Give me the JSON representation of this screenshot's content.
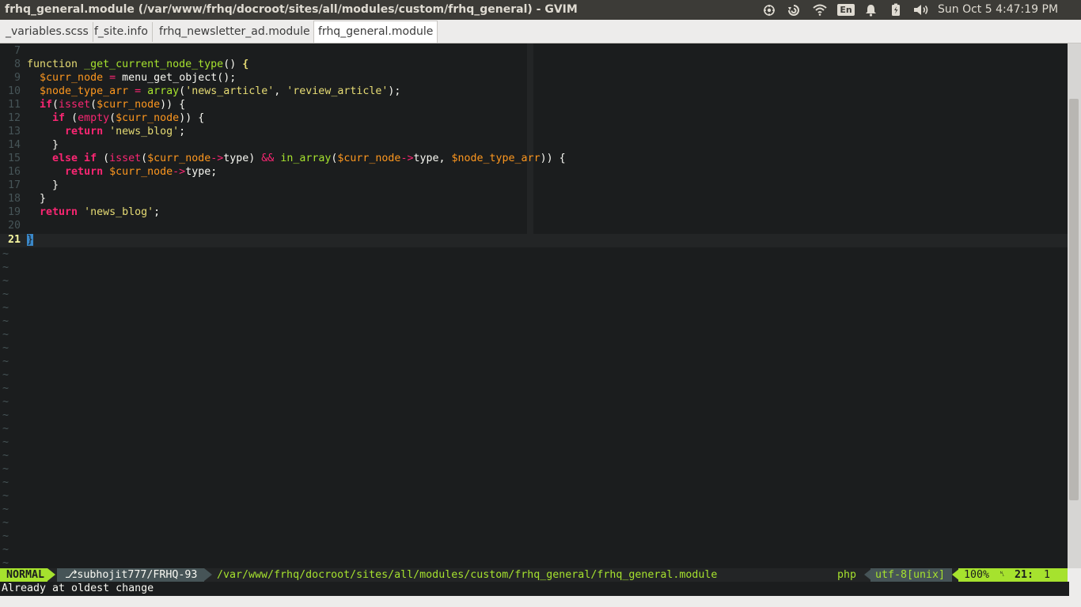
{
  "window": {
    "title": "frhq_general.module (/var/www/frhq/docroot/sites/all/modules/custom/frhq_general) - GVIM"
  },
  "tray": {
    "icons": [
      "sync-indicator-icon",
      "dropbox-icon",
      "wifi-icon",
      "keyboard-layout-icon",
      "notification-icon",
      "battery-icon",
      "volume-icon"
    ],
    "keyboard_layout": "En",
    "clock": "Sun Oct  5  4:47:19 PM"
  },
  "tabs": [
    {
      "label": "_variables.scss",
      "active": false
    },
    {
      "label": "f_site.info",
      "active": false
    },
    {
      "label": "frhq_newsletter_ad.module",
      "active": false
    },
    {
      "label": "frhq_general.module",
      "active": true
    }
  ],
  "editor": {
    "lines": [
      {
        "num": "7",
        "text": ""
      },
      {
        "num": "8",
        "text": "function _get_current_node_type() {"
      },
      {
        "num": "9",
        "text": "  $curr_node = menu_get_object();"
      },
      {
        "num": "10",
        "text": "  $node_type_arr = array('news_article', 'review_article');"
      },
      {
        "num": "11",
        "text": "  if(isset($curr_node)) {"
      },
      {
        "num": "12",
        "text": "    if (empty($curr_node)) {"
      },
      {
        "num": "13",
        "text": "      return 'news_blog';"
      },
      {
        "num": "14",
        "text": "    }"
      },
      {
        "num": "15",
        "text": "    else if (isset($curr_node->type) && in_array($curr_node->type, $node_type_arr)) {"
      },
      {
        "num": "16",
        "text": "      return $curr_node->type;"
      },
      {
        "num": "17",
        "text": "    }"
      },
      {
        "num": "18",
        "text": "  }"
      },
      {
        "num": "19",
        "text": "  return 'news_blog';"
      },
      {
        "num": "20",
        "text": ""
      },
      {
        "num": "21",
        "text": "}"
      }
    ],
    "current_line": "21",
    "empty_line_marker": "~"
  },
  "statusline": {
    "mode": "NORMAL",
    "branch": "⎇subhojit777/FRHQ-93",
    "path": "/var/www/frhq/docroot/sites/all/modules/custom/frhq_general/frhq_general.module",
    "filetype": "php",
    "encoding": "utf-8[unix]",
    "percent": "100%",
    "line_symbol": "␤",
    "line": "21:",
    "column": "1"
  },
  "cmdline": {
    "message": "Already at oldest change"
  },
  "colors": {
    "background": "#1b1d1e",
    "keyword": "#f92672",
    "function": "#a6e22e",
    "variable": "#fd971f",
    "string": "#e6db74",
    "statusline_accent": "#a6e22e",
    "cursor": "#3a88c9"
  }
}
